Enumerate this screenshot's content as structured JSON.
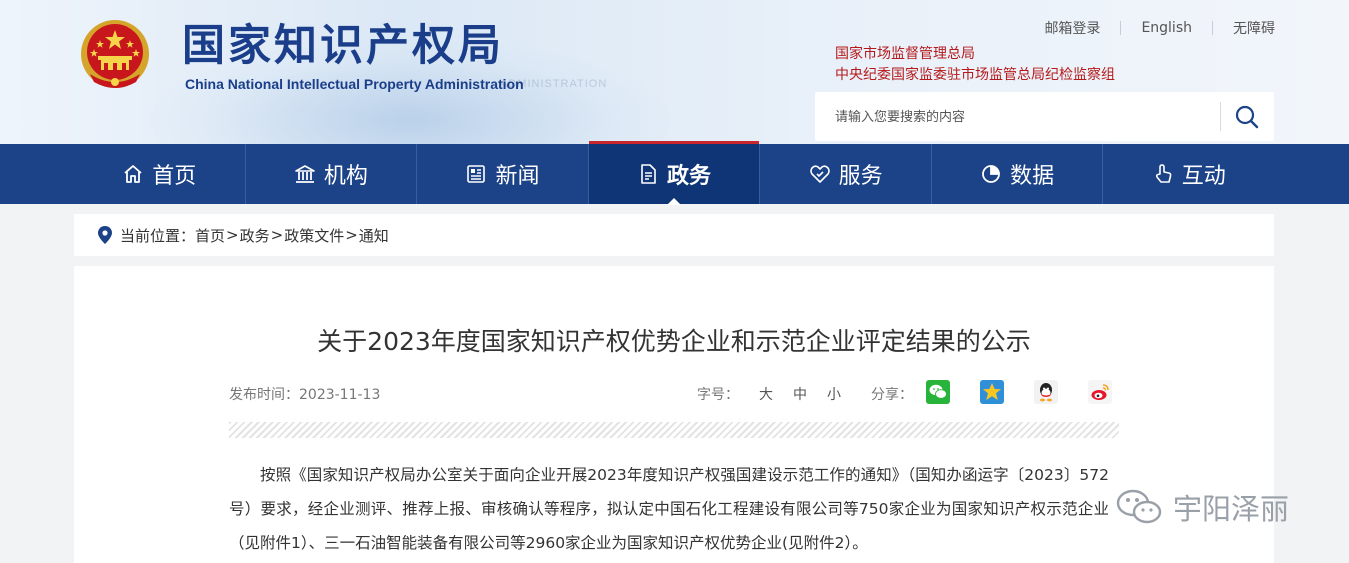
{
  "header": {
    "site_title": "国家知识产权局",
    "site_subtitle": "China National Intellectual Property Administration",
    "top_links": [
      "邮箱登录",
      "English",
      "无障碍"
    ],
    "org_lines": [
      "国家市场监督管理总局",
      "中央纪委国家监委驻市场监管总局纪检监察组"
    ],
    "search_placeholder": "请输入您要搜索的内容"
  },
  "nav": {
    "items": [
      {
        "label": "首页",
        "icon": "home-icon"
      },
      {
        "label": "机构",
        "icon": "institution-icon"
      },
      {
        "label": "新闻",
        "icon": "news-icon"
      },
      {
        "label": "政务",
        "icon": "government-affairs-icon",
        "active": true
      },
      {
        "label": "服务",
        "icon": "service-icon"
      },
      {
        "label": "数据",
        "icon": "data-icon"
      },
      {
        "label": "互动",
        "icon": "interaction-icon"
      }
    ]
  },
  "breadcrumb": {
    "prefix": "当前位置：",
    "items": [
      "首页",
      "政务",
      "政策文件",
      "通知"
    ],
    "separator": ">"
  },
  "article": {
    "title": "关于2023年度国家知识产权优势企业和示范企业评定结果的公示",
    "date_label": "发布时间：",
    "date": "2023-11-13",
    "font_size_label": "字号：",
    "font_sizes": [
      "大",
      "中",
      "小"
    ],
    "share_label": "分享：",
    "share_icons": [
      "wechat-icon",
      "qzone-icon",
      "qq-icon",
      "weibo-icon"
    ],
    "body": "按照《国家知识产权局办公室关于面向企业开展2023年度知识产权强国建设示范工作的通知》（国知办函运字〔2023〕572号）要求，经企业测评、推荐上报、审核确认等程序，拟认定中国石化工程建设有限公司等750家企业为国家知识产权示范企业（见附件1）、三一石油智能装备有限公司等2960家企业为国家知识产权优势企业(见附件2）。"
  },
  "watermark": {
    "text": "宇阳泽丽",
    "icon": "wechat-icon"
  },
  "colors": {
    "nav_bg": "#1c4287",
    "nav_active_bg": "#0f3577",
    "title_blue": "#1b3e8a",
    "org_red": "#b51a1a",
    "page_bg": "#f2f3f5"
  }
}
